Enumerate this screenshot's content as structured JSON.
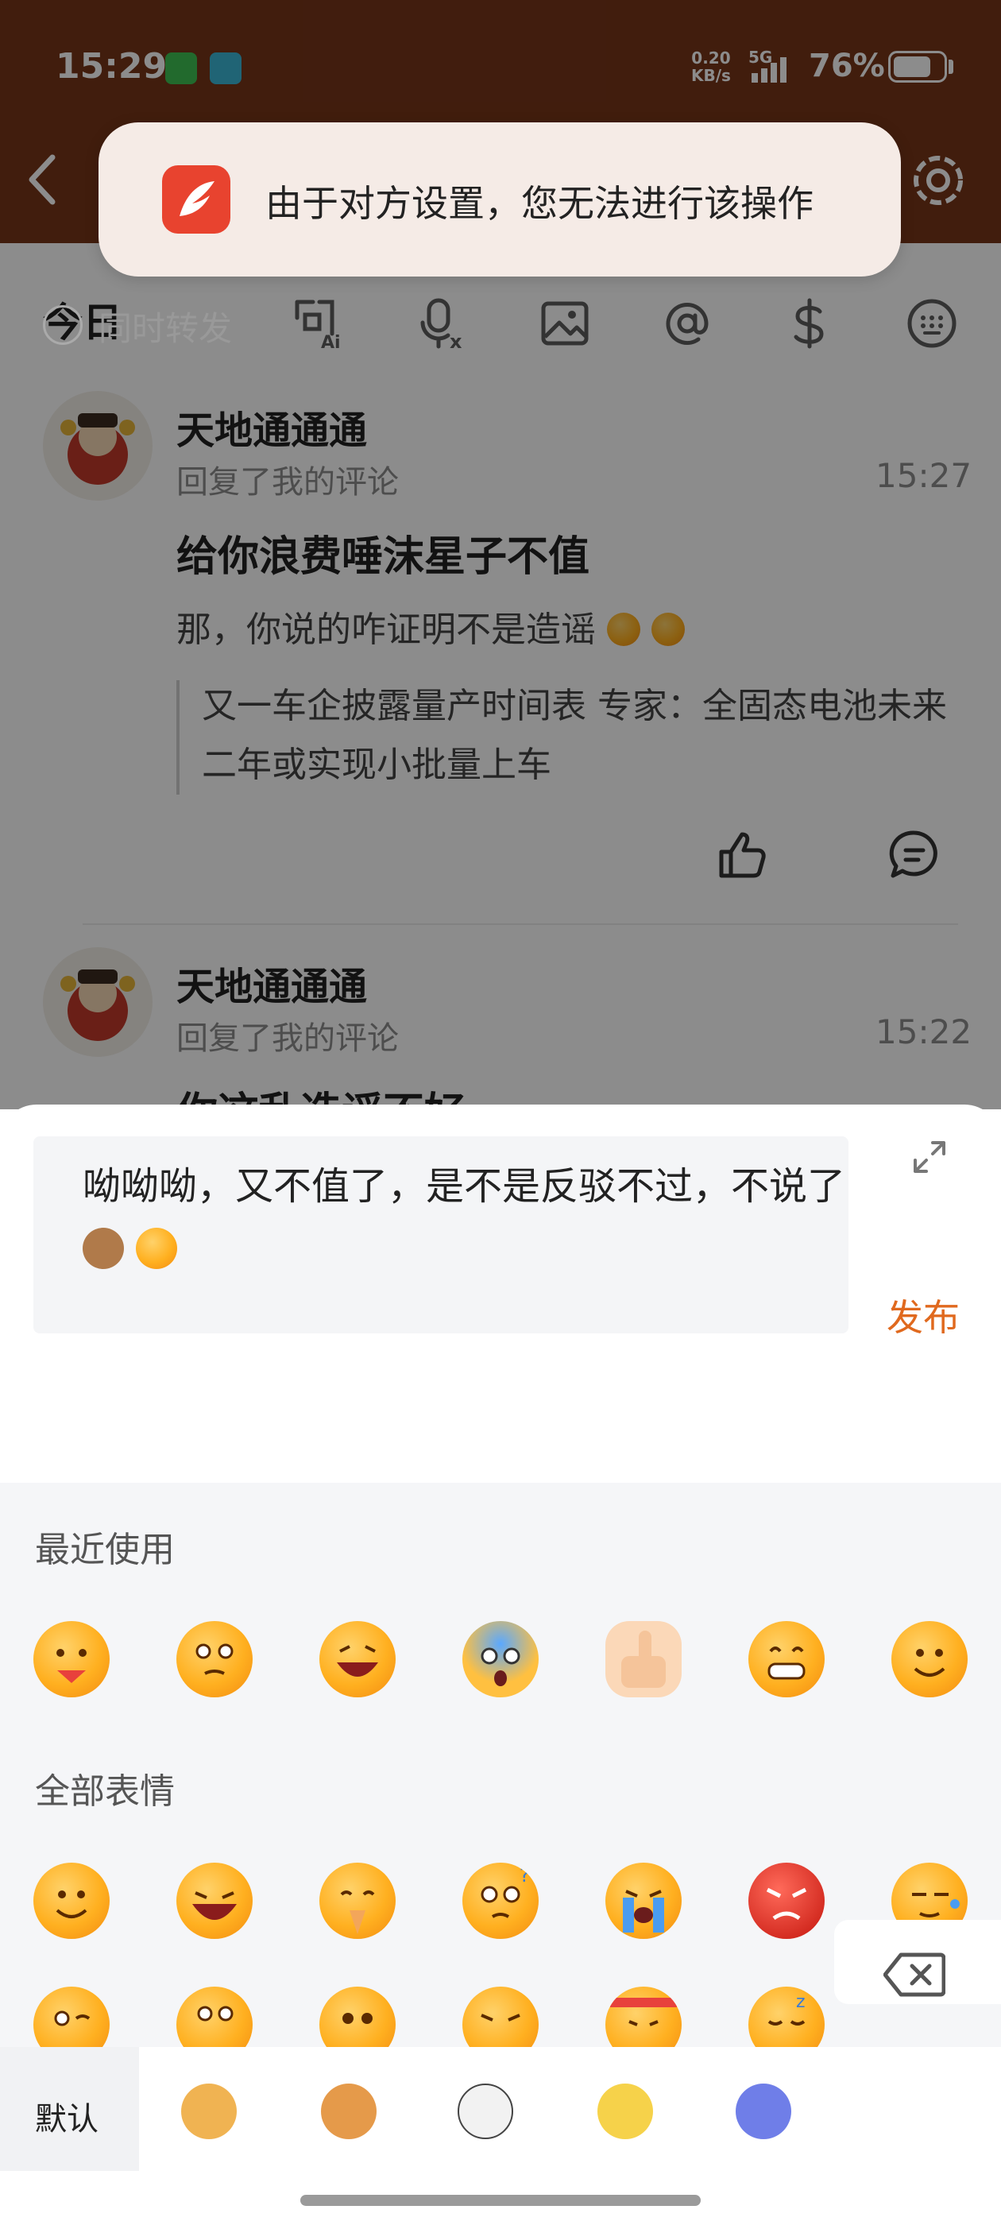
{
  "status_bar": {
    "time": "15:29",
    "net_speed_value": "0.20",
    "net_speed_unit": "KB/s",
    "network": "5G",
    "battery": "76%"
  },
  "colors": {
    "header": "#773519",
    "accent": "#e0691e",
    "toast_bg": "#f5ebe6"
  },
  "content": {
    "section_today": "今日",
    "notifications": [
      {
        "user": "天地通通通",
        "action": "回复了我的评论",
        "time": "15:27",
        "reply": "给你浪费唾沫星子不值",
        "quoted": "那，你说的咋证明不是造谣",
        "article": "又一车企披露量产时间表 专家：全固态电池未来二年或实现小批量上车",
        "icons": [
          "like-icon",
          "comment-icon"
        ]
      },
      {
        "user": "天地通通通",
        "action": "回复了我的评论",
        "time": "15:22",
        "reply": "你这乱造谣不好"
      }
    ]
  },
  "toast": {
    "icon": "app-feather-icon",
    "text": "由于对方设置，您无法进行该操作"
  },
  "composer": {
    "input_text": "呦呦呦，又不值了，是不是反驳不过，不说了",
    "publish": "发布",
    "repost_label": "同时转发",
    "tools": [
      "ai-wording-icon",
      "voice-to-text-icon",
      "image-icon",
      "at-icon",
      "dollar-icon",
      "keyboard-icon"
    ]
  },
  "emoji_panel": {
    "recent_title": "最近使用",
    "all_title": "全部表情",
    "recent": [
      "watermelon-face",
      "thinking-face",
      "grinning-face",
      "shocked-face",
      "thumbs-up",
      "grin-face",
      "smile-face"
    ],
    "all_row1": [
      "smile-face",
      "laughing-face",
      "pray-face",
      "confused-face",
      "crying-face",
      "angry-face",
      "sweat-face"
    ],
    "all_row2": [
      "wink-tongue-face",
      "pondering-face",
      "pleading-face",
      "laughing-tears-face",
      "headband-face",
      "sleeping-face"
    ]
  },
  "tabbar": {
    "default_label": "默认",
    "stickers": [
      "ox-ok-sticker",
      "ox-sign-sticker",
      "ox-sketch-sticker",
      "fortune-sticker",
      "robot-sticker"
    ]
  }
}
